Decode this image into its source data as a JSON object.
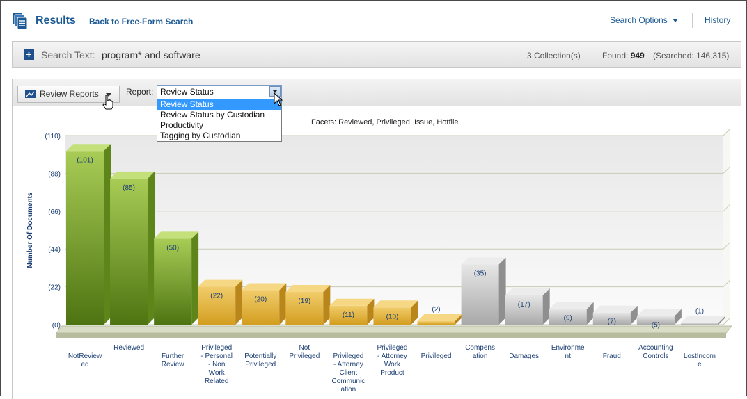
{
  "header": {
    "title": "Results",
    "back_link": "Back to Free-Form Search",
    "search_options": "Search Options",
    "history": "History"
  },
  "search_bar": {
    "label": "Search Text:",
    "value": "program* and software",
    "collections": "3 Collection(s)",
    "found_label": "Found:",
    "found_value": "949",
    "searched": "(Searched: 146,315)"
  },
  "toolbar": {
    "review_reports": "Review Reports",
    "report_label": "Report:",
    "report_selected": "Review Status",
    "report_options": [
      "Review Status",
      "Review Status by Custodian",
      "Productivity",
      "Tagging by Custodian"
    ]
  },
  "colors": {
    "green": "#7da82a",
    "gold": "#e5b43c",
    "gray": "#bdbdbd",
    "link": "#1c5a94"
  },
  "chart_data": {
    "type": "bar",
    "title": "Facets: Reviewed, Privileged, Issue, Hotfile",
    "ylabel": "Number Of Documents",
    "ylim": [
      0,
      110
    ],
    "yticks": [
      "(0)",
      "(22)",
      "(44)",
      "(66)",
      "(88)",
      "(110)"
    ],
    "yvalues": [
      0,
      22,
      44,
      66,
      88,
      110
    ],
    "categories": [
      [
        "NotReview",
        "ed"
      ],
      [
        "Reviewed"
      ],
      [
        "Further",
        "Review"
      ],
      [
        "Privileged",
        "- Personal",
        "- Non",
        "Work",
        "Related"
      ],
      [
        "Potentially",
        "Privileged"
      ],
      [
        "Not",
        "Privileged"
      ],
      [
        "Privileged",
        "- Attorney",
        "Client",
        "Communic",
        "ation"
      ],
      [
        "Privileged",
        "- Attorney",
        "Work",
        "Product"
      ],
      [
        "Privileged"
      ],
      [
        "Compens",
        "ation"
      ],
      [
        "Damages"
      ],
      [
        "Environme",
        "nt"
      ],
      [
        "Fraud"
      ],
      [
        "Accounting",
        "Controls"
      ],
      [
        "LostIncom",
        "e"
      ]
    ],
    "values": [
      101,
      85,
      50,
      22,
      20,
      19,
      11,
      10,
      2,
      35,
      17,
      9,
      7,
      5,
      1
    ],
    "data_labels": [
      "(101)",
      "(85)",
      "(50)",
      "(22)",
      "(20)",
      "(19)",
      "(11)",
      "(10)",
      "(2)",
      "(35)",
      "(17)",
      "(9)",
      "(7)",
      "(5)",
      "(1)"
    ],
    "groups": [
      "green",
      "green",
      "green",
      "gold",
      "gold",
      "gold",
      "gold",
      "gold",
      "gold",
      "gray",
      "gray",
      "gray",
      "gray",
      "gray",
      "gray"
    ],
    "grid": true
  }
}
